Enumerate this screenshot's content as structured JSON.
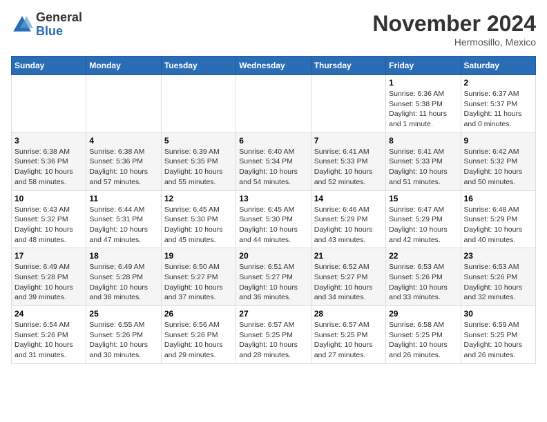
{
  "header": {
    "logo_general": "General",
    "logo_blue": "Blue",
    "month_title": "November 2024",
    "location": "Hermosillo, Mexico"
  },
  "days_of_week": [
    "Sunday",
    "Monday",
    "Tuesday",
    "Wednesday",
    "Thursday",
    "Friday",
    "Saturday"
  ],
  "weeks": [
    [
      {
        "day": "",
        "info": ""
      },
      {
        "day": "",
        "info": ""
      },
      {
        "day": "",
        "info": ""
      },
      {
        "day": "",
        "info": ""
      },
      {
        "day": "",
        "info": ""
      },
      {
        "day": "1",
        "info": "Sunrise: 6:36 AM\nSunset: 5:38 PM\nDaylight: 11 hours and 1 minute."
      },
      {
        "day": "2",
        "info": "Sunrise: 6:37 AM\nSunset: 5:37 PM\nDaylight: 11 hours and 0 minutes."
      }
    ],
    [
      {
        "day": "3",
        "info": "Sunrise: 6:38 AM\nSunset: 5:36 PM\nDaylight: 10 hours and 58 minutes."
      },
      {
        "day": "4",
        "info": "Sunrise: 6:38 AM\nSunset: 5:36 PM\nDaylight: 10 hours and 57 minutes."
      },
      {
        "day": "5",
        "info": "Sunrise: 6:39 AM\nSunset: 5:35 PM\nDaylight: 10 hours and 55 minutes."
      },
      {
        "day": "6",
        "info": "Sunrise: 6:40 AM\nSunset: 5:34 PM\nDaylight: 10 hours and 54 minutes."
      },
      {
        "day": "7",
        "info": "Sunrise: 6:41 AM\nSunset: 5:33 PM\nDaylight: 10 hours and 52 minutes."
      },
      {
        "day": "8",
        "info": "Sunrise: 6:41 AM\nSunset: 5:33 PM\nDaylight: 10 hours and 51 minutes."
      },
      {
        "day": "9",
        "info": "Sunrise: 6:42 AM\nSunset: 5:32 PM\nDaylight: 10 hours and 50 minutes."
      }
    ],
    [
      {
        "day": "10",
        "info": "Sunrise: 6:43 AM\nSunset: 5:32 PM\nDaylight: 10 hours and 48 minutes."
      },
      {
        "day": "11",
        "info": "Sunrise: 6:44 AM\nSunset: 5:31 PM\nDaylight: 10 hours and 47 minutes."
      },
      {
        "day": "12",
        "info": "Sunrise: 6:45 AM\nSunset: 5:30 PM\nDaylight: 10 hours and 45 minutes."
      },
      {
        "day": "13",
        "info": "Sunrise: 6:45 AM\nSunset: 5:30 PM\nDaylight: 10 hours and 44 minutes."
      },
      {
        "day": "14",
        "info": "Sunrise: 6:46 AM\nSunset: 5:29 PM\nDaylight: 10 hours and 43 minutes."
      },
      {
        "day": "15",
        "info": "Sunrise: 6:47 AM\nSunset: 5:29 PM\nDaylight: 10 hours and 42 minutes."
      },
      {
        "day": "16",
        "info": "Sunrise: 6:48 AM\nSunset: 5:29 PM\nDaylight: 10 hours and 40 minutes."
      }
    ],
    [
      {
        "day": "17",
        "info": "Sunrise: 6:49 AM\nSunset: 5:28 PM\nDaylight: 10 hours and 39 minutes."
      },
      {
        "day": "18",
        "info": "Sunrise: 6:49 AM\nSunset: 5:28 PM\nDaylight: 10 hours and 38 minutes."
      },
      {
        "day": "19",
        "info": "Sunrise: 6:50 AM\nSunset: 5:27 PM\nDaylight: 10 hours and 37 minutes."
      },
      {
        "day": "20",
        "info": "Sunrise: 6:51 AM\nSunset: 5:27 PM\nDaylight: 10 hours and 36 minutes."
      },
      {
        "day": "21",
        "info": "Sunrise: 6:52 AM\nSunset: 5:27 PM\nDaylight: 10 hours and 34 minutes."
      },
      {
        "day": "22",
        "info": "Sunrise: 6:53 AM\nSunset: 5:26 PM\nDaylight: 10 hours and 33 minutes."
      },
      {
        "day": "23",
        "info": "Sunrise: 6:53 AM\nSunset: 5:26 PM\nDaylight: 10 hours and 32 minutes."
      }
    ],
    [
      {
        "day": "24",
        "info": "Sunrise: 6:54 AM\nSunset: 5:26 PM\nDaylight: 10 hours and 31 minutes."
      },
      {
        "day": "25",
        "info": "Sunrise: 6:55 AM\nSunset: 5:26 PM\nDaylight: 10 hours and 30 minutes."
      },
      {
        "day": "26",
        "info": "Sunrise: 6:56 AM\nSunset: 5:26 PM\nDaylight: 10 hours and 29 minutes."
      },
      {
        "day": "27",
        "info": "Sunrise: 6:57 AM\nSunset: 5:25 PM\nDaylight: 10 hours and 28 minutes."
      },
      {
        "day": "28",
        "info": "Sunrise: 6:57 AM\nSunset: 5:25 PM\nDaylight: 10 hours and 27 minutes."
      },
      {
        "day": "29",
        "info": "Sunrise: 6:58 AM\nSunset: 5:25 PM\nDaylight: 10 hours and 26 minutes."
      },
      {
        "day": "30",
        "info": "Sunrise: 6:59 AM\nSunset: 5:25 PM\nDaylight: 10 hours and 26 minutes."
      }
    ]
  ]
}
